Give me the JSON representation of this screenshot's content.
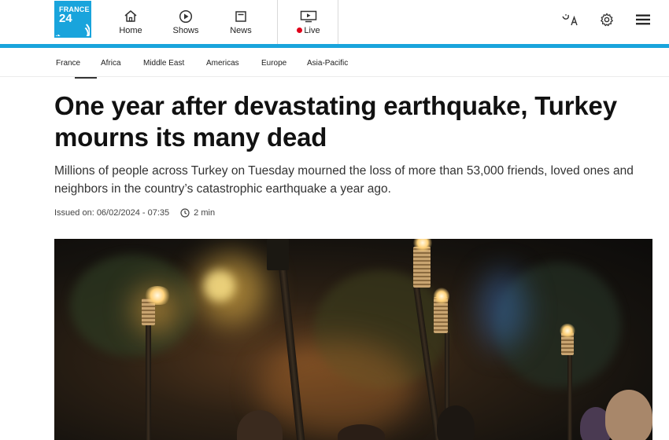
{
  "header": {
    "logo": {
      "line1": "FRANCE",
      "line2": "24"
    },
    "nav": [
      {
        "label": "Home",
        "icon": "home-icon"
      },
      {
        "label": "Shows",
        "icon": "play-circle-icon"
      },
      {
        "label": "News",
        "icon": "news-icon"
      },
      {
        "label": "Live",
        "icon": "tv-icon"
      }
    ],
    "live_dot_color": "#e0001a",
    "right_icons": [
      "language-icon",
      "gear-icon",
      "menu-icon"
    ],
    "accent_color": "#19a4dc"
  },
  "subnav": {
    "items": [
      "France",
      "Africa",
      "Middle East",
      "Americas",
      "Europe",
      "Asia-Pacific"
    ]
  },
  "article": {
    "title": "One year after devastating earthquake, Turkey mourns its many dead",
    "lede": "Millions of people across Turkey on Tuesday mourned the loss of more than 53,000 friends, loved ones and neighbors in the country’s catastrophic earthquake a year ago.",
    "issued": "Issued on: 06/02/2024 - 07:35",
    "read_time": "2 min"
  }
}
